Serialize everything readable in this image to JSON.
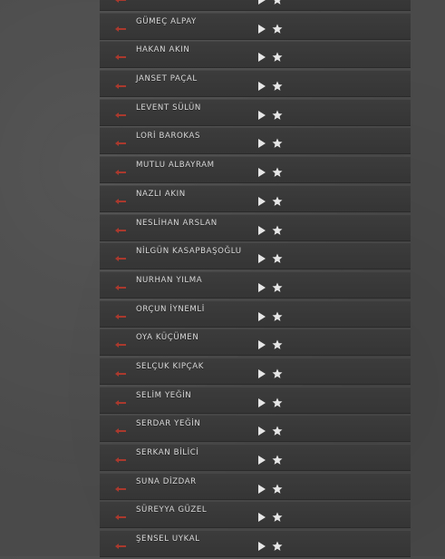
{
  "colors": {
    "accent_arrow": "#c0392b",
    "text": "#dcdcdc",
    "icon": "#e6e6e6"
  },
  "icons": {
    "leading": "arrow-icon",
    "play": "play-icon",
    "favorite": "star-icon"
  },
  "artists": [
    "",
    "GÜMEÇ ALPAY",
    "HAKAN AKIN",
    "JANSET PAÇAL",
    "LEVENT SÜLÜN",
    "LORİ BAROKAS",
    "MUTLU ALBAYRAM",
    "NAZLI AKIN",
    "NESLİHAN ARSLAN",
    "NİLGÜN KASAPBAŞOĞLU",
    "NURHAN YILMA",
    "ORÇUN İYNEMLİ",
    "OYA KÜÇÜMEN",
    "SELÇUK KIPÇAK",
    "SELİM YEĞİN",
    "SERDAR YEĞİN",
    "SERKAN BİLİCİ",
    "SUNA DİZDAR",
    "SÜREYYA GÜZEL",
    "ŞENSEL UYKAL"
  ]
}
